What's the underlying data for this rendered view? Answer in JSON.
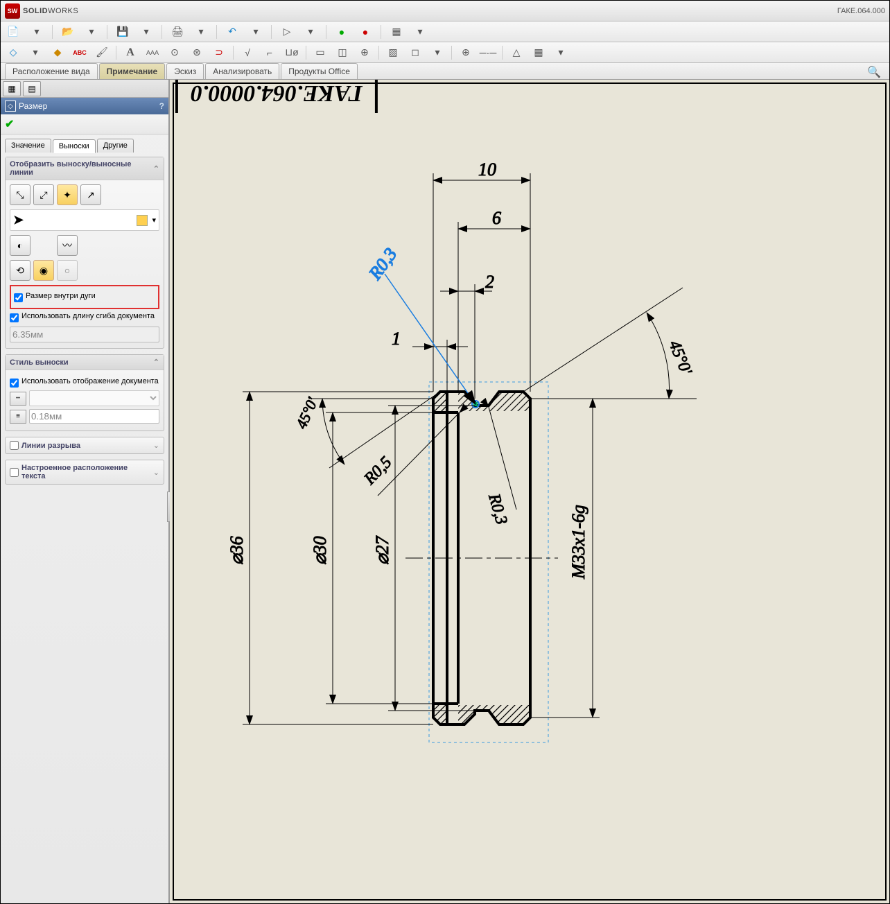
{
  "app": {
    "name_bold": "SOLID",
    "name_light": "WORKS",
    "logo": "SW",
    "doc_title": "ГАКЕ.064.000"
  },
  "ribbon": {
    "tabs": [
      "Расположение вида",
      "Примечание",
      "Эскиз",
      "Анализировать",
      "Продукты Office"
    ],
    "active_index": 1
  },
  "panel": {
    "title": "Размер",
    "subtabs": [
      "Значение",
      "Выноски",
      "Другие"
    ],
    "active_subtab": 1,
    "section_leader": "Отобразить выноску/выносные линии",
    "chk_inside_arc": "Размер внутри дуги",
    "chk_use_bend": "Использовать длину сгиба документа",
    "bend_value": "6.35мм",
    "section_style": "Стиль выноски",
    "chk_use_doc_display": "Использовать отображение документа",
    "thickness_value": "0.18мм",
    "section_break": "Линии разрыва",
    "section_custom": "Настроенное расположение текста"
  },
  "drawing": {
    "title_text": "ГАКЕ.064.0000.0",
    "dims": {
      "d10": "10",
      "d6": "6",
      "d2": "2",
      "d1": "1",
      "r03a": "R0,3",
      "r05": "R0,5",
      "r03b": "R0,3",
      "ang1": "45°0'",
      "ang2": "45°0'",
      "dia36": "⌀36",
      "dia30": "⌀30",
      "dia27": "⌀27",
      "thread": "M33x1-6g"
    }
  }
}
